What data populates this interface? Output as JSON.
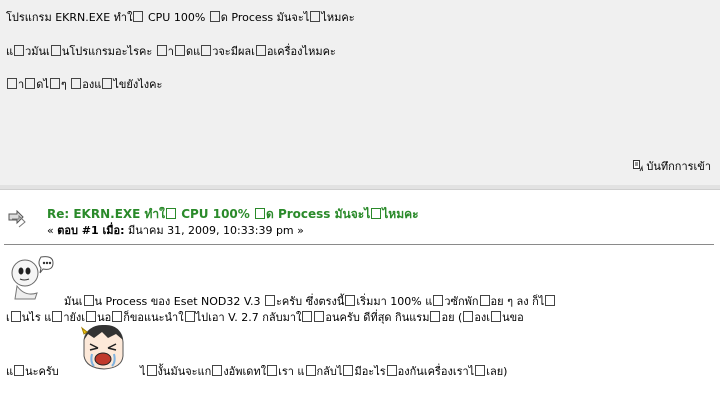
{
  "question": {
    "line1_a": "โปรแกรม EKRN.EXE ทำใ",
    "line1_b": " CPU 100% ",
    "line1_c": "ด Process มันจะไ",
    "line1_d": "ไหมคะ",
    "line2_a": "แ",
    "line2_b": "วมันเ",
    "line2_c": "นโปรแกรมอะไรคะ ",
    "line2_d": "า",
    "line2_e": "ดแ",
    "line2_f": "วจะมีผลเ",
    "line2_g": "อเครื่องไหมคะ",
    "line3_a": "า",
    "line3_b": "ดไ",
    "line3_c": "ๆ ",
    "line3_d": "องแ",
    "line3_e": "ไขยังไงคะ",
    "note_label": "บันทึกการเข้า"
  },
  "reply": {
    "title": "Re: EKRN.EXE ทำใ CPU 100% ด Process มันจะไ ไหมคะ",
    "title_a": "Re: EKRN.EXE ทำใ",
    "title_b": " CPU 100% ",
    "title_c": "ด Process มันจะไ",
    "title_d": "ไหมคะ",
    "meta_prefix": "« ",
    "meta_label": "ตอบ #1 เมื่อ:",
    "meta_date": " มีนาคม 31, 2009, 10:33:39 pm »",
    "body1_a": "มันเ",
    "body1_b": "น Process ของ Eset NOD32 V.3 ",
    "body1_c": "ะครับ ซึ่งตรงนี้",
    "body1_d": "เริ่มมา 100% แ",
    "body1_e": "วซักพัก",
    "body1_f": "อย ๆ ลง ก็ไ",
    "body2_a": "เ",
    "body2_b": "นไร แ",
    "body2_c": "ายังเ",
    "body2_d": "นอ",
    "body2_e": "ก็ขอแนะนำใ",
    "body2_f": "ไปเอา V. 2.7 กลับมาใ",
    "body2_g": "อนครับ ดีที่สุด กินแรม",
    "body2_h": "อย (",
    "body2_i": "องเ",
    "body2_j": "นขอ",
    "body3_a": "แ",
    "body3_b": "นะครับ",
    "body3_c": "ไ",
    "body3_d": "งั้นมันจะแก",
    "body3_e": "งอัพเดทใ",
    "body3_f": "เรา แ",
    "body3_g": "กลับไ",
    "body3_h": "มีอะไร",
    "body3_i": "องกันเครื่องเราไ",
    "body3_j": "เลย)"
  },
  "icons": {
    "note_icon": "note-icon",
    "reply_icon": "xfer-icon",
    "smiley_1": "thinking-smiley-icon",
    "smiley_2": "crying-smiley-icon"
  },
  "colors": {
    "title_green": "#2a8a2a",
    "top_bg": "#f0f0f0"
  }
}
